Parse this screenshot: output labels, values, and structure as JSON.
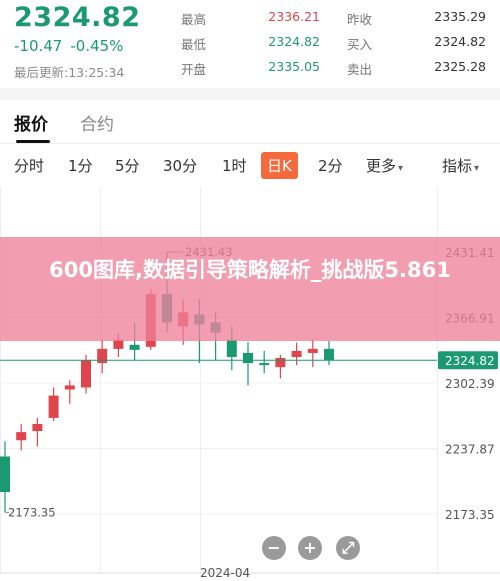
{
  "quote": {
    "price": "2324.82",
    "change": "-10.47",
    "change_pct": "-0.45%",
    "update_time": "最后更新:13:25:34",
    "stats": [
      {
        "label": "最高",
        "value": "2336.21",
        "color": "red"
      },
      {
        "label": "最低",
        "value": "2324.82",
        "color": "green"
      },
      {
        "label": "开盘",
        "value": "2335.05",
        "color": "green"
      },
      {
        "label": "昨收",
        "value": "2335.29",
        "color": "dark"
      },
      {
        "label": "买入",
        "value": "2324.82",
        "color": "dark"
      },
      {
        "label": "卖出",
        "value": "2325.28",
        "color": "dark"
      }
    ]
  },
  "tabs": [
    "报价",
    "合约"
  ],
  "periods": {
    "items": [
      "分时",
      "1分",
      "5分",
      "30分",
      "1时",
      "日K",
      "2分",
      "更多",
      "指标"
    ],
    "active": "日K",
    "more_caret": "▾"
  },
  "chart_data": {
    "type": "candlestick",
    "y_ticks": [
      "2431.41",
      "2366.91",
      "2302.39",
      "2237.87",
      "2173.35"
    ],
    "current_price_label": "2324.82",
    "max_marker": "2431.43",
    "min_marker": "2173.35",
    "x_label": "2024-04",
    "ylim": [
      2173.35,
      2431.41
    ],
    "colors": {
      "up": "#e0454b",
      "down": "#1b9a72",
      "price_line": "#1b9a72"
    },
    "candles": [
      {
        "o": 2230,
        "h": 2245,
        "l": 2175,
        "c": 2195
      },
      {
        "o": 2246,
        "h": 2262,
        "l": 2236,
        "c": 2254
      },
      {
        "o": 2255,
        "h": 2268,
        "l": 2240,
        "c": 2262
      },
      {
        "o": 2268,
        "h": 2298,
        "l": 2265,
        "c": 2290
      },
      {
        "o": 2296,
        "h": 2305,
        "l": 2282,
        "c": 2300
      },
      {
        "o": 2298,
        "h": 2330,
        "l": 2292,
        "c": 2325
      },
      {
        "o": 2322,
        "h": 2345,
        "l": 2312,
        "c": 2336
      },
      {
        "o": 2336,
        "h": 2352,
        "l": 2328,
        "c": 2345
      },
      {
        "o": 2340,
        "h": 2362,
        "l": 2325,
        "c": 2335
      },
      {
        "o": 2338,
        "h": 2395,
        "l": 2335,
        "c": 2390
      },
      {
        "o": 2390,
        "h": 2431.43,
        "l": 2352,
        "c": 2362
      },
      {
        "o": 2358,
        "h": 2385,
        "l": 2340,
        "c": 2372
      },
      {
        "o": 2370,
        "h": 2385,
        "l": 2322,
        "c": 2360
      },
      {
        "o": 2362,
        "h": 2372,
        "l": 2325,
        "c": 2352
      },
      {
        "o": 2345,
        "h": 2358,
        "l": 2315,
        "c": 2328
      },
      {
        "o": 2332,
        "h": 2343,
        "l": 2300,
        "c": 2322
      },
      {
        "o": 2322,
        "h": 2334,
        "l": 2312,
        "c": 2320
      },
      {
        "o": 2318,
        "h": 2330,
        "l": 2307,
        "c": 2327
      },
      {
        "o": 2328,
        "h": 2342,
        "l": 2320,
        "c": 2334
      },
      {
        "o": 2332,
        "h": 2345,
        "l": 2318,
        "c": 2336
      },
      {
        "o": 2336,
        "h": 2344,
        "l": 2320,
        "c": 2324.82
      }
    ]
  },
  "controls": [
    {
      "name": "zoom-out-button",
      "glyph": "−"
    },
    {
      "name": "zoom-in-button",
      "glyph": "+"
    },
    {
      "name": "fullscreen-button",
      "glyph": "⤢"
    }
  ],
  "banner": {
    "text": "600图库,数据引导策略解析_挑战版5.861"
  }
}
